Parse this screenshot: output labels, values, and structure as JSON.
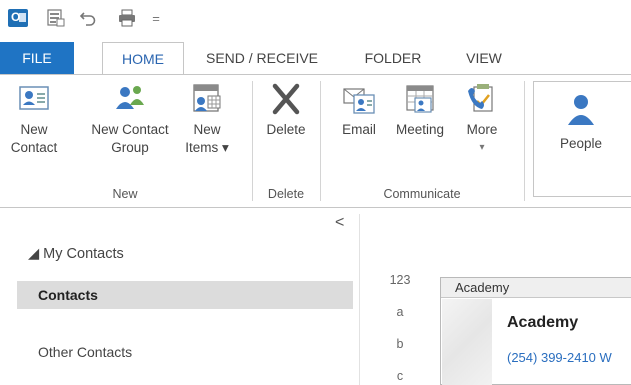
{
  "app": {
    "quick_access": [
      {
        "name": "outlook-logo"
      },
      {
        "name": "send-receive-all-icon"
      },
      {
        "name": "undo-icon"
      },
      {
        "name": "print-icon"
      },
      {
        "name": "customize-qat-icon",
        "glyph": "="
      }
    ]
  },
  "tabs": {
    "file": "FILE",
    "home": "HOME",
    "send_receive": "SEND / RECEIVE",
    "folder": "FOLDER",
    "view": "VIEW"
  },
  "ribbon": {
    "new_contact": {
      "line1": "New",
      "line2": "Contact",
      "icon": "contact-card-icon"
    },
    "new_contact_group": {
      "line1": "New Contact",
      "line2": "Group",
      "icon": "people-group-icon"
    },
    "new_items": {
      "line1": "New",
      "line2": "Items ▾",
      "icon": "new-items-icon"
    },
    "delete": {
      "line1": "Delete",
      "icon": "delete-x-icon"
    },
    "email": {
      "line1": "Email",
      "icon": "email-contact-icon"
    },
    "meeting": {
      "line1": "Meeting",
      "icon": "meeting-icon"
    },
    "more": {
      "line1": "More",
      "line2": "▾",
      "icon": "more-communicate-icon"
    },
    "people": {
      "line1": "People",
      "icon": "person-icon"
    },
    "groups": {
      "new": "New",
      "delete": "Delete",
      "communicate": "Communicate"
    },
    "accent_color": "#1f74c4"
  },
  "nav": {
    "collapse_glyph": "<",
    "header": "◢ My Contacts",
    "items": [
      "Contacts",
      "Other Contacts"
    ]
  },
  "alpha_index": [
    "123",
    "a",
    "b",
    "c"
  ],
  "card": {
    "header": "Academy",
    "name": "Academy",
    "phone": "(254) 399-2410 W"
  }
}
